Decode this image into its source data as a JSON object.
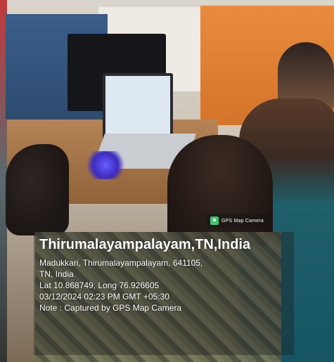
{
  "stamp": {
    "brand_icon": "gps-map-camera-icon",
    "brand": "GPS Map Camera",
    "place": "Thirumalayampalayam,TN,India",
    "address_line1": "Madukkari, Thirumalayampalayam, 641105,",
    "address_line2": "TN, India",
    "coords": "Lat 10.868749, Long 76.926605",
    "datetime": "03/12/2024 02:23 PM GMT +05:30",
    "note": "Note : Captured by GPS Map Camera"
  }
}
